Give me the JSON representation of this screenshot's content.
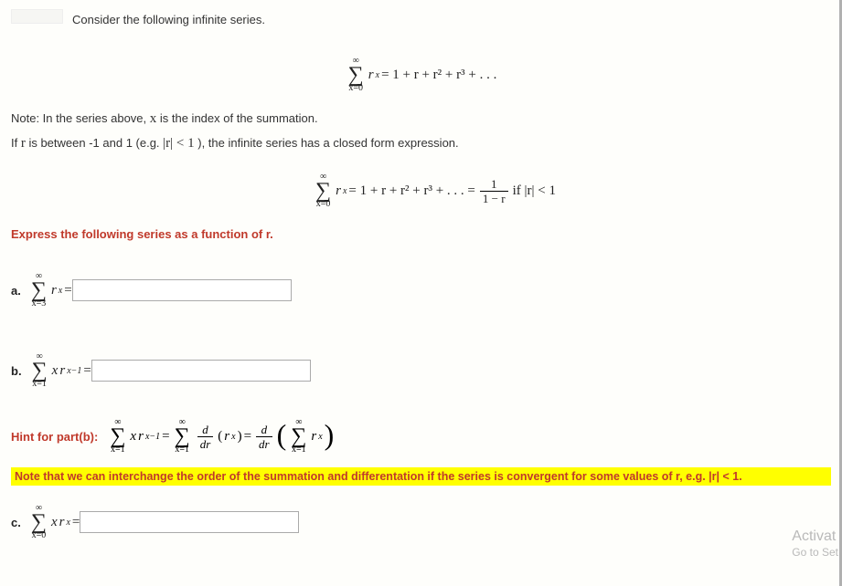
{
  "header": {
    "prompt": "Consider the following infinite series."
  },
  "eq1": {
    "sum_top": "∞",
    "sum_bot": "x=0",
    "term": "r",
    "exp": "x",
    "expansion": " = 1 + r + r² + r³ + . . ."
  },
  "note_line1_a": "Note: In the series above, ",
  "note_line1_var": "x",
  "note_line1_b": " is the index of the summation.",
  "note_line2_a": "If ",
  "note_line2_var1": "r",
  "note_line2_b": " is between -1 and 1 (e.g. ",
  "note_line2_cond": "|r| < 1",
  "note_line2_c": " ), the infinite series has a closed form expression.",
  "eq2": {
    "sum_top": "∞",
    "sum_bot": "x=0",
    "term": "r",
    "exp": "x",
    "expansion_prefix": " = 1 + r + r² + r³ + . . . = ",
    "frac_num": "1",
    "frac_den": "1 − r",
    "cond": " if |r| < 1"
  },
  "instruction": "Express the following series as a function of r.",
  "parts": {
    "a": {
      "label": "a.",
      "sum_top": "∞",
      "sum_bot": "x=3",
      "term": "r",
      "exp": "x",
      "after": " = "
    },
    "b": {
      "label": "b.",
      "sum_top": "∞",
      "sum_bot": "x=1",
      "coef": "x",
      "term": "r",
      "exp": "x−1",
      "after": " = "
    },
    "c": {
      "label": "c.",
      "sum_top": "∞",
      "sum_bot": "x=0",
      "coef": "x",
      "term": "r",
      "exp": "x",
      "after": " = "
    }
  },
  "hint": {
    "label": "Hint for part(b):",
    "s1_top": "∞",
    "s1_bot": "x=1",
    "coef1": "x",
    "t1": "r",
    "e1": "x−1",
    "eq1": " = ",
    "s2_top": "∞",
    "s2_bot": "x=1",
    "dfrac_num": "d",
    "dfrac_den": "dr",
    "t2_base": "r",
    "t2_exp": "x",
    "eq2": " = ",
    "s3_top": "∞",
    "s3_bot": "x=1",
    "t3_base": "r",
    "t3_exp": "x"
  },
  "yellow_note": "Note that we can interchange the order of the summation and differentation if the series is convergent for some values of r, e.g. |r| < 1.",
  "watermark": {
    "line1": "Activat",
    "line2": "Go to Set"
  }
}
